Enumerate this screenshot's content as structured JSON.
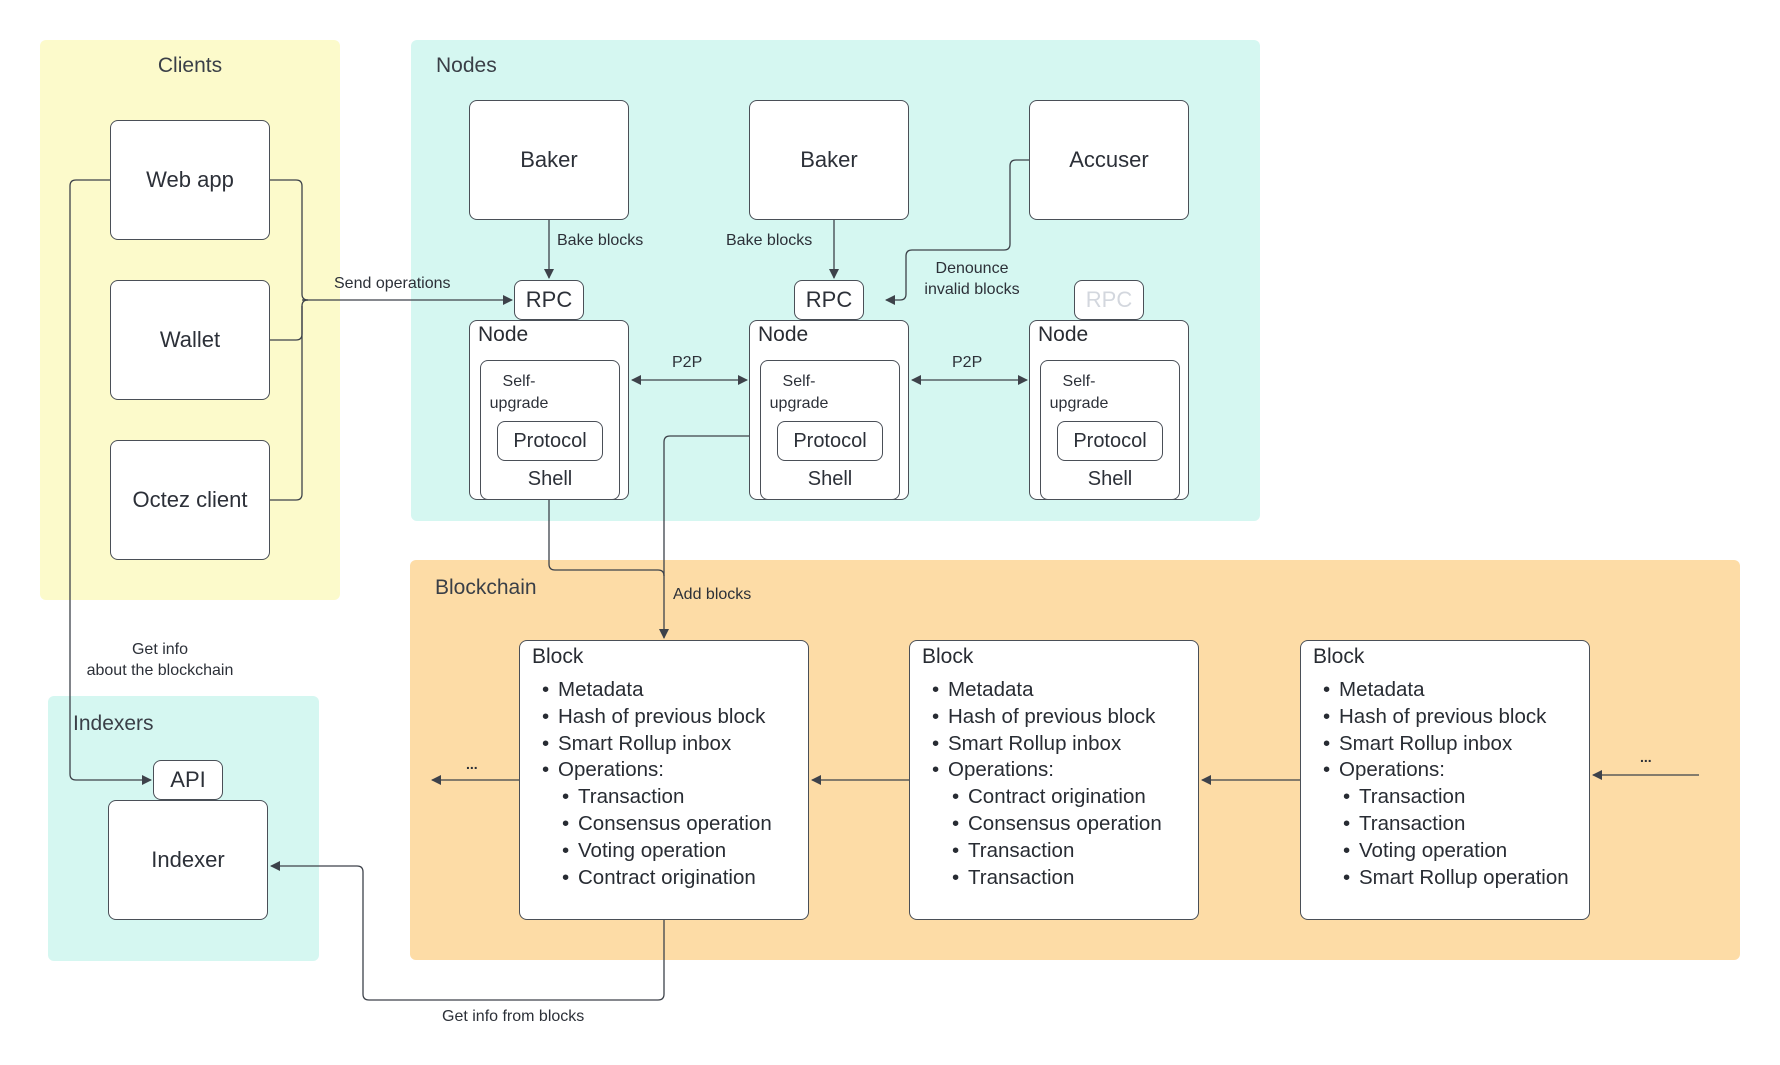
{
  "groups": {
    "clients": {
      "title": "Clients",
      "color": "#fcfacb"
    },
    "nodes": {
      "title": "Nodes",
      "color": "#d5f7f1"
    },
    "blockchain": {
      "title": "Blockchain",
      "color": "#fddca6"
    },
    "indexers": {
      "title": "Indexers",
      "color": "#d5f7f1"
    }
  },
  "clients": [
    {
      "label": "Web app"
    },
    {
      "label": "Wallet"
    },
    {
      "label": "Octez client"
    }
  ],
  "daemons": [
    {
      "label": "Baker"
    },
    {
      "label": "Baker"
    },
    {
      "label": "Accuser"
    }
  ],
  "nodes": [
    {
      "rpc": "RPC",
      "title": "Node",
      "self_upgrade": [
        "Self-",
        "upgrade"
      ],
      "protocol": "Protocol",
      "shell": "Shell",
      "rpc_active": true
    },
    {
      "rpc": "RPC",
      "title": "Node",
      "self_upgrade": [
        "Self-",
        "upgrade"
      ],
      "protocol": "Protocol",
      "shell": "Shell",
      "rpc_active": true
    },
    {
      "rpc": "RPC",
      "title": "Node",
      "self_upgrade": [
        "Self-",
        "upgrade"
      ],
      "protocol": "Protocol",
      "shell": "Shell",
      "rpc_active": false
    }
  ],
  "edge_labels": {
    "send_operations": "Send operations",
    "bake_blocks_1": "Bake blocks",
    "bake_blocks_2": "Bake blocks",
    "denounce": [
      "Denounce",
      "invalid blocks"
    ],
    "p2p_1": "P2P",
    "p2p_2": "P2P",
    "add_blocks": "Add blocks",
    "get_info_chain": [
      "Get info",
      "about the blockchain"
    ],
    "get_info_blocks": "Get info from blocks",
    "ellipsis_left": "...",
    "ellipsis_right": "..."
  },
  "blocks": [
    {
      "title": "Block",
      "items": [
        "Metadata",
        "Hash of previous block",
        "Smart Rollup inbox",
        "Operations:"
      ],
      "operations": [
        "Transaction",
        "Consensus operation",
        "Voting operation",
        "Contract origination"
      ]
    },
    {
      "title": "Block",
      "items": [
        "Metadata",
        "Hash of previous block",
        "Smart Rollup inbox",
        "Operations:"
      ],
      "operations": [
        "Contract origination",
        "Consensus operation",
        "Transaction",
        "Transaction"
      ]
    },
    {
      "title": "Block",
      "items": [
        "Metadata",
        "Hash of previous block",
        "Smart Rollup inbox",
        "Operations:"
      ],
      "operations": [
        "Transaction",
        "Transaction",
        "Voting operation",
        "Smart Rollup operation"
      ]
    }
  ],
  "indexer": {
    "api": "API",
    "label": "Indexer"
  },
  "colors": {
    "line": "#3d424a",
    "faded_text": "#d3d7de"
  }
}
